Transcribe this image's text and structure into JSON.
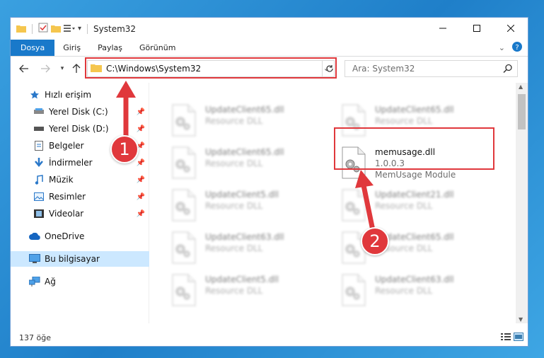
{
  "window": {
    "title": "System32"
  },
  "ribbon": {
    "tabs": [
      "Dosya",
      "Giriş",
      "Paylaş",
      "Görünüm"
    ]
  },
  "address": {
    "path": "C:\\Windows\\System32",
    "search_placeholder": "Ara: System32"
  },
  "nav": {
    "items": [
      {
        "label": "Hızlı erişim",
        "icon": "star-icon",
        "pinned": false
      },
      {
        "label": "Yerel Disk (C:)",
        "icon": "drive-icon",
        "pinned": true
      },
      {
        "label": "Yerel Disk (D:)",
        "icon": "drive-icon",
        "pinned": true
      },
      {
        "label": "Belgeler",
        "icon": "document-icon",
        "pinned": true
      },
      {
        "label": "İndirmeler",
        "icon": "download-icon",
        "pinned": true
      },
      {
        "label": "Müzik",
        "icon": "music-icon",
        "pinned": true
      },
      {
        "label": "Resimler",
        "icon": "pictures-icon",
        "pinned": true
      },
      {
        "label": "Videolar",
        "icon": "video-icon",
        "pinned": true
      },
      {
        "label": "OneDrive",
        "icon": "cloud-icon",
        "pinned": false
      },
      {
        "label": "Bu bilgisayar",
        "icon": "computer-icon",
        "pinned": false
      },
      {
        "label": "Ağ",
        "icon": "network-icon",
        "pinned": false
      }
    ]
  },
  "files": [
    {
      "name": "UpdateClient65.dll",
      "sub1": "Resource DLL",
      "sub2": "",
      "blurred": true
    },
    {
      "name": "UpdateClient65.dll",
      "sub1": "Resource DLL",
      "sub2": "",
      "blurred": true
    },
    {
      "name": "UpdateClient65.dll",
      "sub1": "Resource DLL",
      "sub2": "",
      "blurred": true
    },
    {
      "name": "memusage.dll",
      "sub1": "1.0.0.3",
      "sub2": "MemUsage Module",
      "blurred": false
    },
    {
      "name": "UpdateClient5.dll",
      "sub1": "Resource DLL",
      "sub2": "",
      "blurred": true
    },
    {
      "name": "UpdateClient21.dll",
      "sub1": "Resource DLL",
      "sub2": "",
      "blurred": true
    },
    {
      "name": "UpdateClient63.dll",
      "sub1": "Resource DLL",
      "sub2": "",
      "blurred": true
    },
    {
      "name": "UpdateClient65.dll",
      "sub1": "Resource DLL",
      "sub2": "",
      "blurred": true
    },
    {
      "name": "UpdateClient5.dll",
      "sub1": "Resource DLL",
      "sub2": "",
      "blurred": true
    },
    {
      "name": "UpdateClient63.dll",
      "sub1": "Resource DLL",
      "sub2": "",
      "blurred": true
    }
  ],
  "status": {
    "count": "137 öğe"
  },
  "annotations": {
    "badge1": "1",
    "badge2": "2"
  },
  "colors": {
    "accent": "#1979ca",
    "highlight": "#e0383c",
    "selected": "#cce8ff"
  }
}
